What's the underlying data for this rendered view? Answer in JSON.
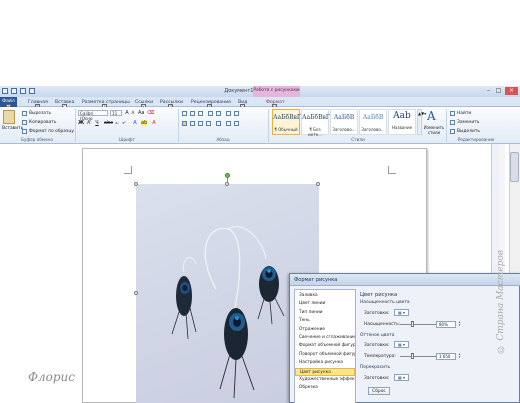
{
  "window": {
    "title": "Документ1 - Microsoft Word",
    "context_group": "Работа с рисунками"
  },
  "tabs": [
    {
      "label": "Файл",
      "key": "Ф"
    },
    {
      "label": "Главная",
      "key": "Я"
    },
    {
      "label": "Вставка",
      "key": "С"
    },
    {
      "label": "Разметка страницы",
      "key": "З"
    },
    {
      "label": "Ссылки",
      "key": "К"
    },
    {
      "label": "Рассылки",
      "key": "Л"
    },
    {
      "label": "Рецензирование",
      "key": "Р"
    },
    {
      "label": "Вид",
      "key": "О"
    },
    {
      "label": "Формат",
      "key": "Ы"
    }
  ],
  "ribbon": {
    "clipboard": {
      "paste": "Вставить",
      "cut": "Вырезать",
      "copy": "Копировать",
      "format_painter": "Формат по образцу",
      "group": "Буфер обмена"
    },
    "font": {
      "name": "Calibri (Осно",
      "size": "11",
      "group": "Шрифт",
      "bold": "Ж",
      "italic": "К",
      "underline": "Ч"
    },
    "paragraph": {
      "group": "Абзац"
    },
    "styles": {
      "items": [
        {
          "sample": "АаБбВвГг",
          "name": "¶ Обычный"
        },
        {
          "sample": "АаБбВвГг",
          "name": "¶ Без инте..."
        },
        {
          "sample": "АаБбВ",
          "name": "Заголово..."
        },
        {
          "sample": "АаБбВ",
          "name": "Заголово..."
        },
        {
          "sample": "Aab",
          "name": "Название"
        }
      ],
      "change": "Изменить стили",
      "group": "Стили"
    },
    "editing": {
      "find": "Найти",
      "replace": "Заменить",
      "select": "Выделить",
      "group": "Редактирование"
    }
  },
  "dialog": {
    "title": "Формат рисунка",
    "nav": [
      "Заливка",
      "Цвет линии",
      "Тип линии",
      "Тень",
      "Отражение",
      "Свечение и сглаживание",
      "Формат объемной фигуры",
      "Поворот объемной фигуры",
      "Настройка рисунка",
      "Цвет рисунка",
      "Художественные эффекты",
      "Обрезка"
    ],
    "selected_nav": "Цвет рисунка",
    "panel": {
      "heading": "Цвет рисунка",
      "saturation_section": "Насыщенность цвета",
      "presets": "Заготовки:",
      "saturation_label": "Насыщенность:",
      "saturation_value": "80%",
      "saturation_level": 0.3,
      "tone_section": "Оттенок цвета",
      "tone_presets": "Заготовки:",
      "temperature_label": "Температура:",
      "temperature_value": "3 650",
      "temperature_level": 0.3,
      "recolor_section": "Перекрасить",
      "recolor_presets": "Заготовки:",
      "reset": "Сброс"
    }
  },
  "watermarks": {
    "left": "Флорис",
    "right": "© Страна Мастеров"
  }
}
